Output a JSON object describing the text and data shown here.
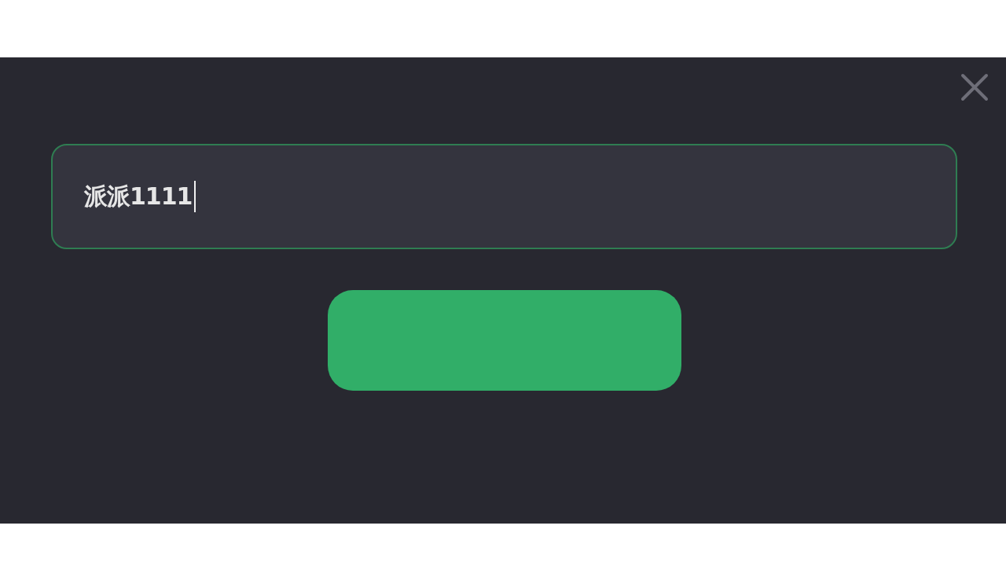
{
  "dialog": {
    "field": {
      "value": "派派1111",
      "focused": true
    }
  }
}
